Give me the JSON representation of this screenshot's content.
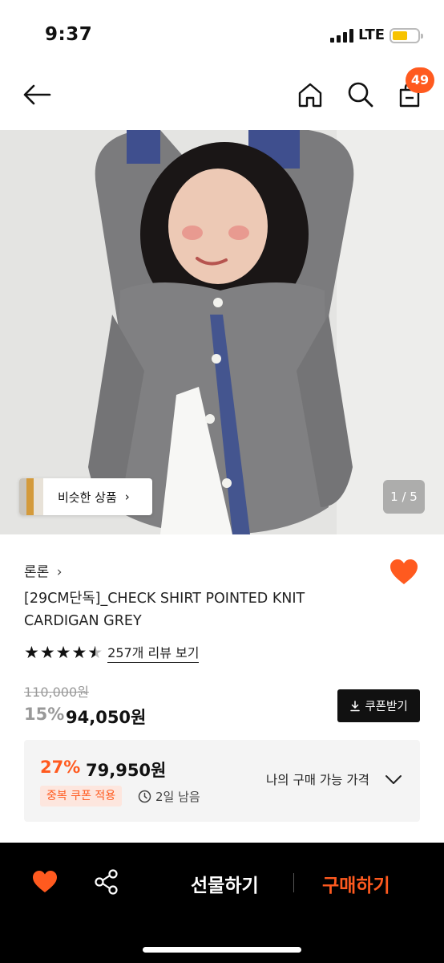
{
  "status_bar": {
    "time": "9:37",
    "network": "LTE"
  },
  "header": {
    "cart_count": "49"
  },
  "gallery": {
    "similar_label": "비슷한 상품",
    "pager": "1 / 5"
  },
  "product": {
    "brand": "론론",
    "title": "[29CM단독]_CHECK SHIRT POINTED KNIT CARDIGAN GREY",
    "rating": 4.5,
    "review_link": "257개 리뷰 보기",
    "original_price": "110,000원",
    "discount_rate": "15%",
    "sale_price": "94,050원",
    "coupon_button": "쿠폰받기"
  },
  "my_price": {
    "discount_rate": "27%",
    "price": "79,950원",
    "tag": "중복 쿠폰 적용",
    "timer": "2일 남음",
    "label": "나의 구매 가능 가격"
  },
  "bottom_bar": {
    "gift": "선물하기",
    "buy": "구매하기"
  },
  "colors": {
    "accent": "#ff5a1f",
    "bar": "#000000",
    "box": "#f4f4f4"
  }
}
